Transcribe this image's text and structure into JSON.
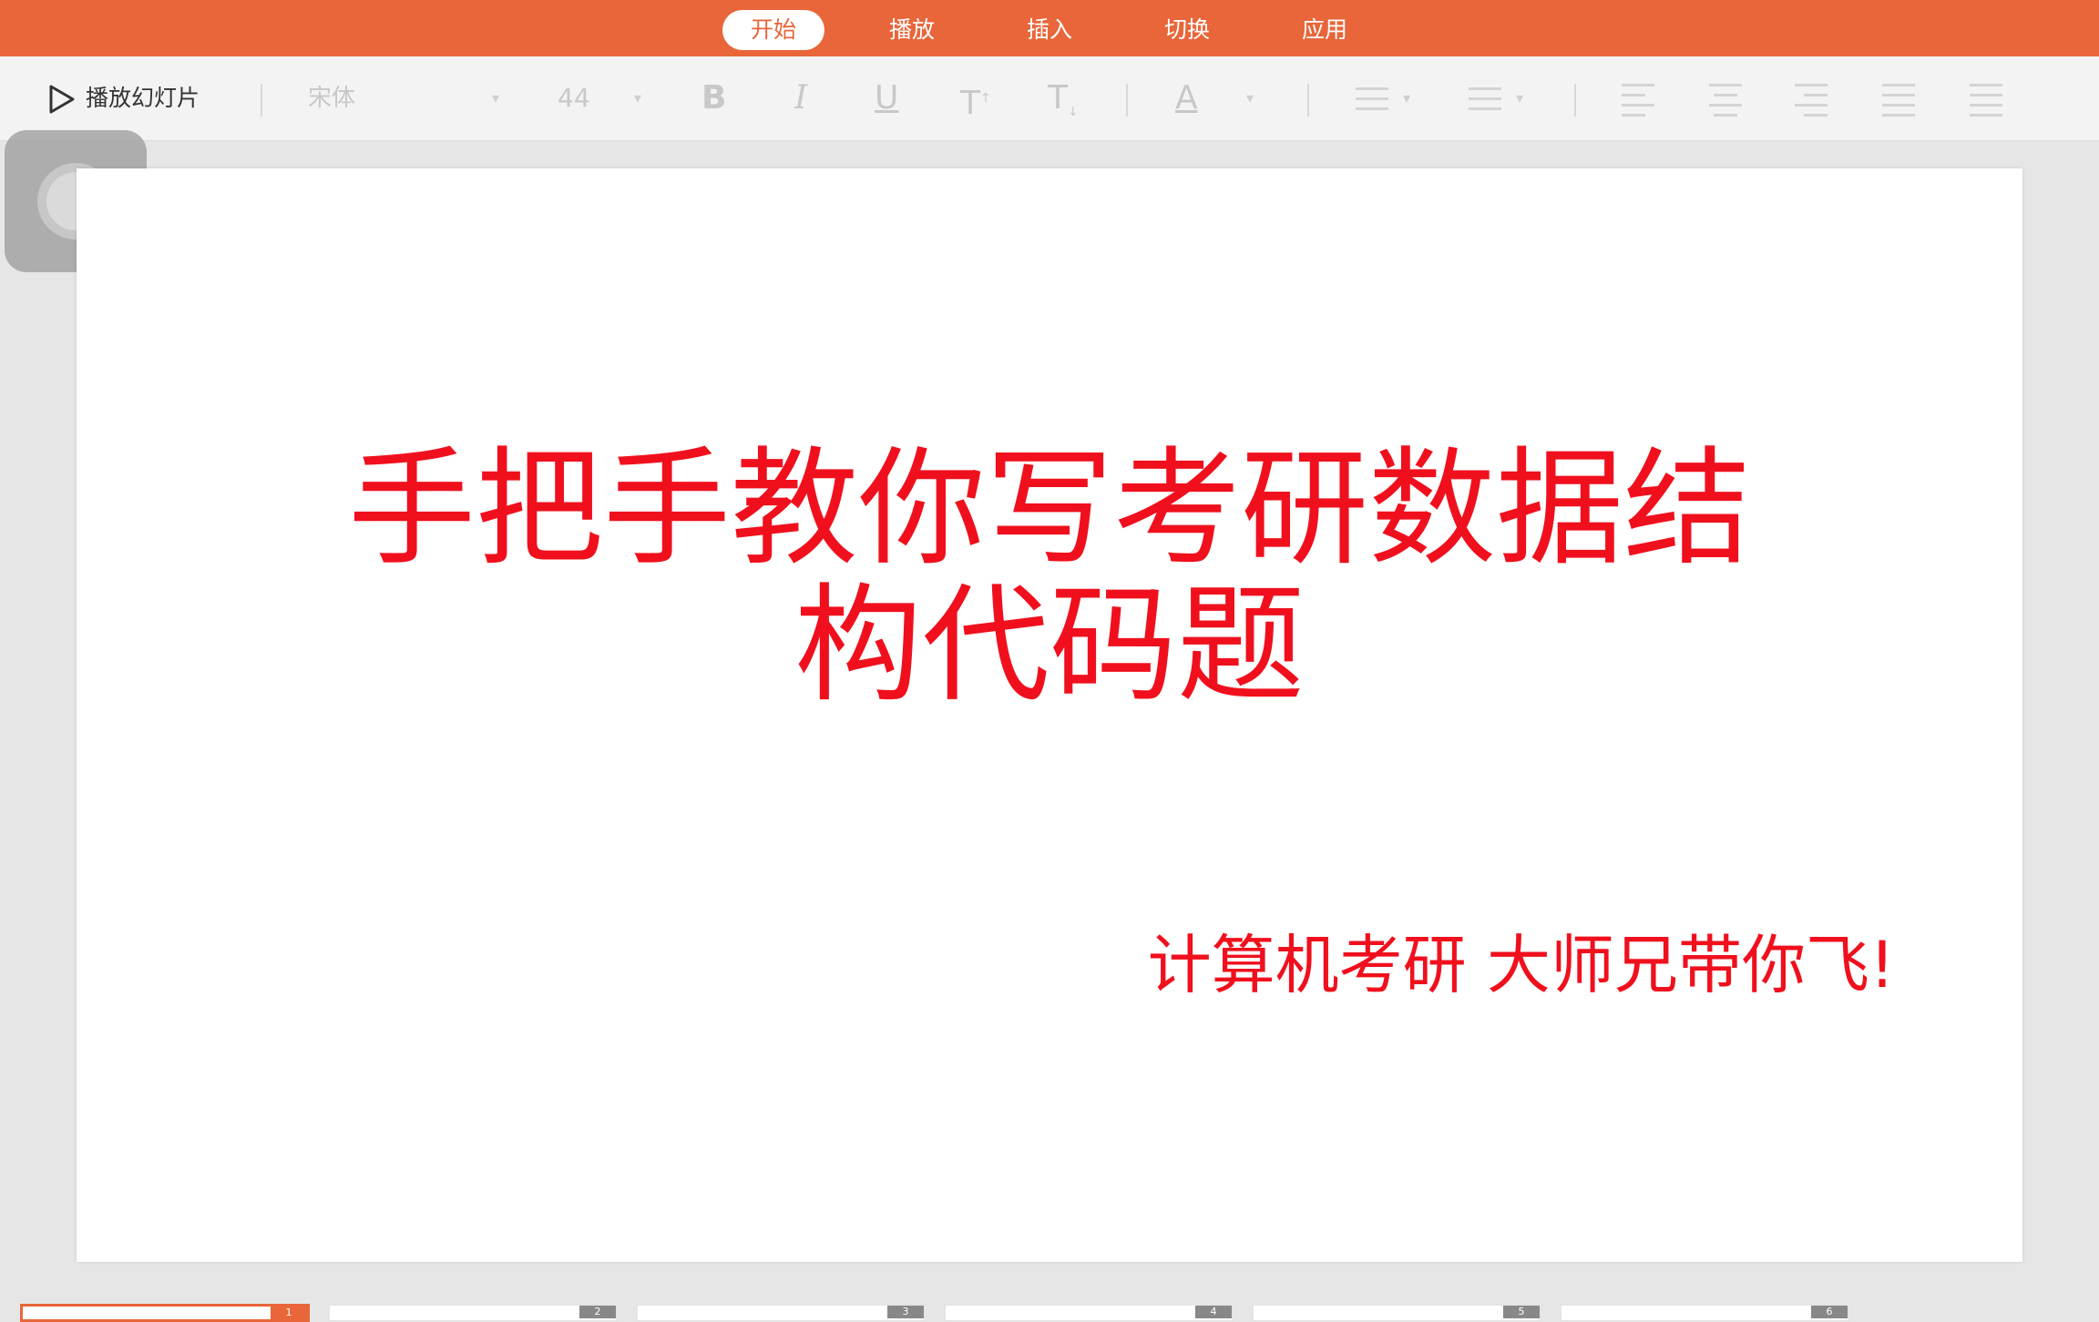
{
  "tabs": [
    {
      "label": "开始",
      "active": true
    },
    {
      "label": "播放",
      "active": false
    },
    {
      "label": "插入",
      "active": false
    },
    {
      "label": "切换",
      "active": false
    },
    {
      "label": "应用",
      "active": false
    }
  ],
  "toolbar": {
    "play_label": "播放幻灯片",
    "font_name": "宋体",
    "font_size": "44",
    "bold": "B",
    "italic": "I",
    "underline": "U",
    "superscript": "T",
    "subscript": "T",
    "font_color": "A"
  },
  "slide": {
    "title_line1": "手把手教你写考研数据结",
    "title_line2": "构代码题",
    "subtitle": "计算机考研 大师兄带你飞!"
  },
  "thumbnails": [
    {
      "number": "1",
      "selected": true
    },
    {
      "number": "2",
      "selected": false
    },
    {
      "number": "3",
      "selected": false
    },
    {
      "number": "4",
      "selected": false
    },
    {
      "number": "5",
      "selected": false
    },
    {
      "number": "6",
      "selected": false
    }
  ],
  "colors": {
    "accent": "#e8663a",
    "title_red": "#f0101d"
  },
  "icons": {
    "play": "play-icon",
    "assistive_touch": "assistive-touch-icon"
  }
}
